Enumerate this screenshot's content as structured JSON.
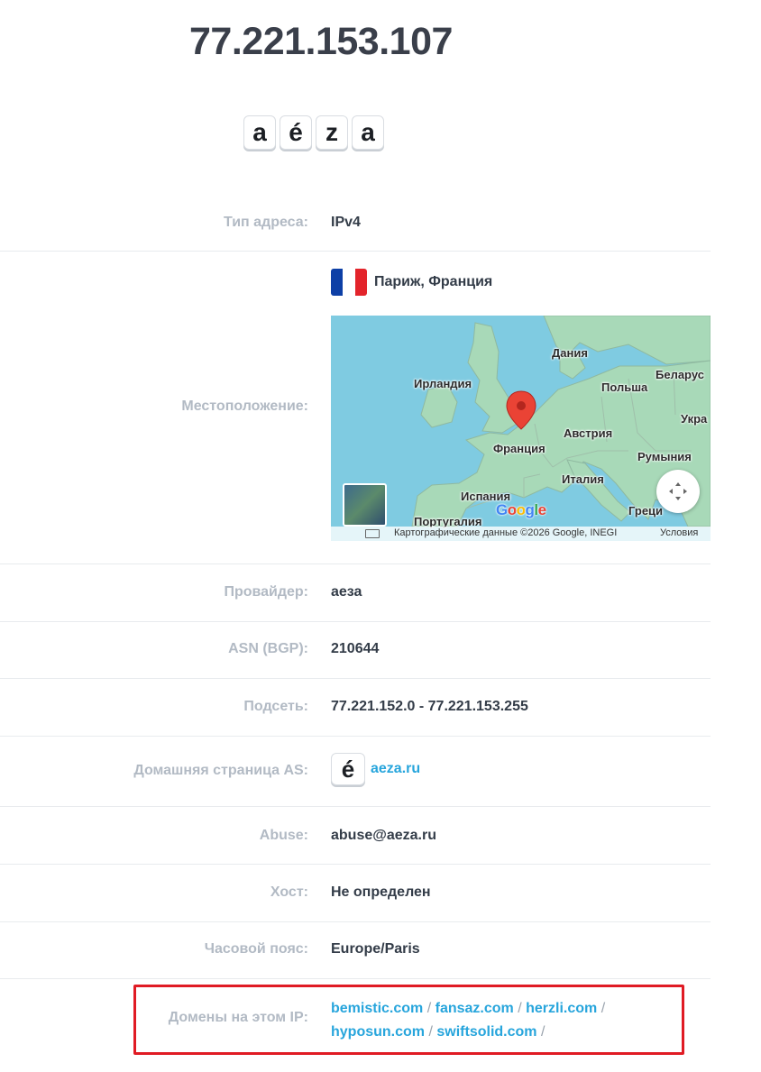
{
  "ip": "77.221.153.107",
  "provider_logo": [
    "a",
    "é",
    "z",
    "a"
  ],
  "rows": {
    "type": {
      "label": "Тип адреса:",
      "value": "IPv4"
    },
    "location": {
      "label": "Местоположение:",
      "value": "Париж, Франция",
      "flag_colors": [
        "#0d3fa6",
        "#ffffff",
        "#e3242b"
      ]
    },
    "provider": {
      "label": "Провайдер:",
      "value": "аеза"
    },
    "asn": {
      "label": "ASN (BGP):",
      "value": "210644"
    },
    "subnet": {
      "label": "Подсеть:",
      "value": "77.221.152.0 - 77.221.153.255"
    },
    "as_home": {
      "label": "Домашняя страница AS:",
      "icon": "é",
      "value": "aeza.ru"
    },
    "abuse": {
      "label": "Abuse:",
      "value": "abuse@aeza.ru"
    },
    "host": {
      "label": "Хост:",
      "value": "Не определен"
    },
    "timezone": {
      "label": "Часовой пояс:",
      "value": "Europe/Paris"
    },
    "domains": {
      "label": "Домены на этом IP:",
      "items": [
        "bemistic.com",
        "fansaz.com",
        "herzli.com",
        "hyposun.com",
        "swiftsolid.com"
      ],
      "separator": "/"
    }
  },
  "map": {
    "labels": {
      "denmark": "Дания",
      "belarus": "Беларус",
      "ireland": "Ирландия",
      "poland": "Польша",
      "ukraine": "Укра",
      "austria": "Австрия",
      "france": "Франция",
      "romania": "Румыния",
      "italy": "Италия",
      "spain": "Испания",
      "greece": "Греци",
      "portugal": "Португалия"
    },
    "google": "Google",
    "attribution": "Картографические данные ©2026 Google, INEGI",
    "terms": "Условия",
    "colors": {
      "water": "#7fcbe1",
      "land": "#a8d9b8",
      "marker": "#ea4335",
      "highlight": "#e01b24"
    }
  }
}
